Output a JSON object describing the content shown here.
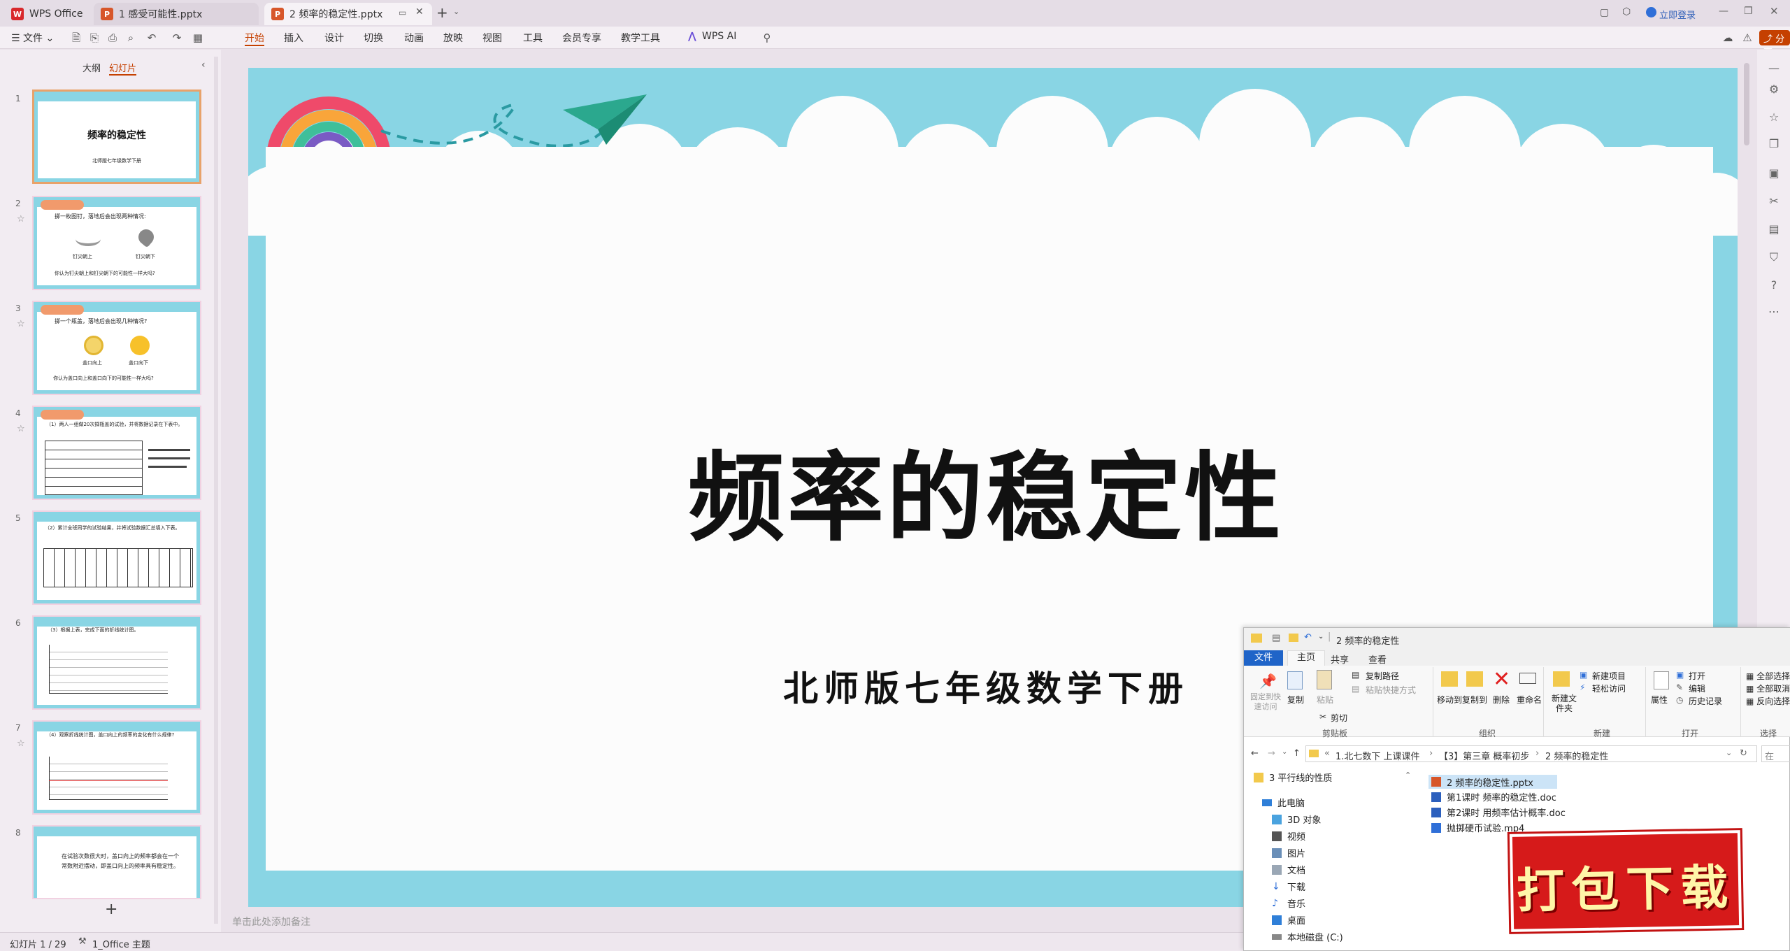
{
  "tabs": [
    {
      "label": "WPS Office",
      "icon": "wps-logo-icon"
    },
    {
      "label": "1 感受可能性.pptx",
      "icon": "ppt-file-icon"
    },
    {
      "label": "2 频率的稳定性.pptx",
      "icon": "ppt-file-icon"
    }
  ],
  "titlebar": {
    "login_label": "立即登录"
  },
  "menubar": {
    "file": "文件",
    "items": [
      "开始",
      "插入",
      "设计",
      "切换",
      "动画",
      "放映",
      "视图",
      "工具",
      "会员专享",
      "教学工具"
    ],
    "wps_ai": "WPS AI",
    "share": "分享"
  },
  "leftpanel": {
    "tabs": [
      "大纲",
      "幻灯片"
    ],
    "thumbs": [
      {
        "num": "1",
        "title": "频率的稳定性",
        "sub": "北师版七年级数学下册"
      },
      {
        "num": "2",
        "line1": "掷一枚图钉，落地后会出现两种情况:",
        "cap1": "钉尖朝上",
        "cap2": "钉尖朝下",
        "q": "你认为钉尖朝上和钉尖朝下的可能性一样大吗?"
      },
      {
        "num": "3",
        "line1": "掷一个瓶盖，落地后会出现几种情况?",
        "cap1": "盖口向上",
        "cap2": "盖口向下",
        "q": "你认为盖口向上和盖口向下的可能性一样大吗?"
      },
      {
        "num": "4",
        "line1": "（1）两人一组做20次掷瓶盖的试验，并将数据记录在下表中。"
      },
      {
        "num": "5",
        "line1": "（2）累计全班同学的试验结果，并将试验数据汇总填入下表。"
      },
      {
        "num": "6",
        "line1": "（3）根据上表，完成下面的折线统计图。"
      },
      {
        "num": "7",
        "line1": "（4）观察折线统计图，盖口向上的频率的变化有什么规律?"
      },
      {
        "num": "8",
        "line1": "在试验次数很大时，盖口向上的频率都会在一个常数附近摆动，即盖口向上的频率具有稳定性。"
      }
    ]
  },
  "slide": {
    "title": "频率的稳定性",
    "subtitle": "北师版七年级数学下册"
  },
  "notes_placeholder": "单击此处添加备注",
  "status": {
    "slide_counter": "幻灯片 1 / 29",
    "theme": "1_Office 主题"
  },
  "explorer": {
    "title": "2 频率的稳定性",
    "tabs": [
      "文件",
      "主页",
      "共享",
      "查看"
    ],
    "ribbon": {
      "pin": "固定到快速访问",
      "copy": "复制",
      "paste": "粘贴",
      "copy_path": "复制路径",
      "paste_shortcut": "粘贴快捷方式",
      "cut": "剪切",
      "group_clipboard": "剪贴板",
      "move_to": "移动到",
      "copy_to": "复制到",
      "delete": "删除",
      "rename": "重命名",
      "group_organize": "组织",
      "new_folder": "新建文件夹",
      "new_item": "新建项目",
      "easy_access": "轻松访问",
      "group_new": "新建",
      "properties": "属性",
      "open": "打开",
      "edit": "编辑",
      "history": "历史记录",
      "group_open": "打开",
      "select_all": "全部选择",
      "select_none": "全部取消",
      "invert": "反向选择",
      "group_select": "选择"
    },
    "address": [
      "1.北七数下 上课课件",
      "【3】第三章 概率初步",
      "2 频率的稳定性"
    ],
    "search_placeholder": "在",
    "nav": {
      "pinned": "3 平行线的性质",
      "this_pc": "此电脑",
      "items": [
        "3D 对象",
        "视频",
        "图片",
        "文档",
        "下载",
        "音乐",
        "桌面",
        "本地磁盘 (C:)"
      ]
    },
    "files": [
      "2 频率的稳定性.pptx",
      "第1课时  频率的稳定性.doc",
      "第2课时  用频率估计概率.doc",
      "抛掷硬币试验.mp4"
    ]
  },
  "badge": {
    "text": "打包下载"
  }
}
